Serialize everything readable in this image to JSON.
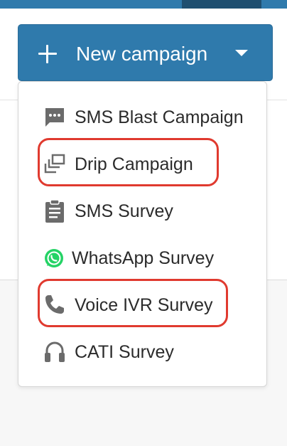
{
  "header": {
    "new_campaign_label": "New campaign"
  },
  "menu": {
    "items": [
      {
        "label": "SMS Blast Campaign",
        "icon": "sms-message-icon"
      },
      {
        "label": "Drip Campaign",
        "icon": "layered-cards-icon",
        "highlighted": true
      },
      {
        "label": "SMS Survey",
        "icon": "clipboard-icon"
      },
      {
        "label": "WhatsApp Survey",
        "icon": "whatsapp-icon"
      },
      {
        "label": "Voice IVR Survey",
        "icon": "phone-icon",
        "highlighted": true
      },
      {
        "label": "CATI Survey",
        "icon": "headset-icon"
      }
    ]
  },
  "colors": {
    "primary": "#2f7aac",
    "highlight": "#e03a2f",
    "whatsapp": "#25d366",
    "icon_gray": "#6b6b6b"
  }
}
